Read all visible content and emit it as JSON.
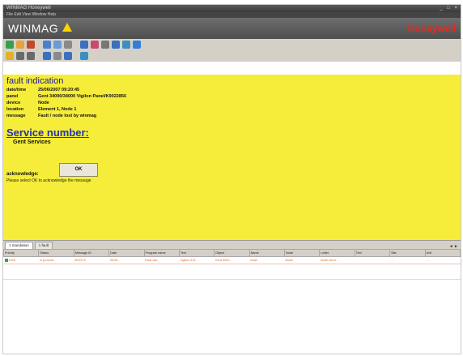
{
  "window": {
    "title": "WINMAG Honeywell",
    "controls": "_ □ ×",
    "menu": "File  Edit  View  Window  Help"
  },
  "header": {
    "app_name": "WINMAG",
    "brand": "Honeywell",
    "accent_color": "#e52b20",
    "warning_icon": "warning-triangle-icon"
  },
  "toolbar": {
    "row1": [
      {
        "icon": "exit-icon",
        "color": "#37a04a"
      },
      {
        "icon": "folder-icon",
        "color": "#e8a23a"
      },
      {
        "icon": "alarm-icon",
        "color": "#c2472c"
      },
      {
        "icon": "help-icon",
        "color": "#4a7fd0"
      },
      {
        "icon": "display-icon",
        "color": "#6a9ad8"
      },
      {
        "icon": "grid-icon",
        "color": "#8a8a8a"
      },
      {
        "icon": "window-icon",
        "color": "#3b6fc0"
      },
      {
        "icon": "palette-icon",
        "color": "#c94a6a"
      },
      {
        "icon": "target-icon",
        "color": "#777777"
      },
      {
        "icon": "window-blue-icon",
        "color": "#3b6fc0"
      },
      {
        "icon": "window-green-icon",
        "color": "#3b8fc0"
      },
      {
        "icon": "info-icon",
        "color": "#2f7fd8"
      }
    ],
    "row2": [
      {
        "icon": "warning-icon",
        "color": "#e2b12a"
      },
      {
        "icon": "clock-icon",
        "color": "#6a6a6a"
      },
      {
        "icon": "gear-icon",
        "color": "#6a6a6a"
      },
      {
        "icon": "edit-icon",
        "color": "#3b6fc0"
      },
      {
        "icon": "document-icon",
        "color": "#8a8a8a"
      },
      {
        "icon": "window-icon",
        "color": "#3b6fc0"
      },
      {
        "icon": "monitor-icon",
        "color": "#3b8fc0"
      }
    ]
  },
  "fault": {
    "title": "fault indication",
    "fields": [
      {
        "label": "date/time",
        "value": "25/06/2007 09:20:45"
      },
      {
        "label": "panel",
        "value": "Gent 34000/34000 Vigilon Panel/K9022856"
      },
      {
        "label": "device",
        "value": "Node"
      },
      {
        "label": "location",
        "value": "Element 1, Node 1"
      },
      {
        "label": "message",
        "value": "Fault / node lost by winmag"
      }
    ],
    "service_number_label": "Service number:",
    "service_name": "Gent Services",
    "acknowledge_label": "acknowledge:",
    "acknowledge_hint": "Please select OK to acknowledge the message",
    "ok_label": "OK"
  },
  "panel": {
    "tabs": [
      {
        "label": "1 mandation",
        "active": true
      },
      {
        "label": "1 fault",
        "active": false
      }
    ],
    "tab_control": "◄ ►",
    "columns": [
      "Priority",
      "Status",
      "Message ID",
      "Date",
      "Program name",
      "Text",
      "Object",
      "Name",
      "Node",
      "Letter",
      "Text",
      "Site",
      "Unit"
    ],
    "rows": [
      [
        "1000",
        "In process",
        "9K9X79",
        "06.05...",
        "Fault war",
        "Vigilon X-B...",
        "Gent 3000 ...",
        "Node",
        "Node",
        "Node lost b...",
        "",
        "…",
        "…"
      ]
    ]
  }
}
